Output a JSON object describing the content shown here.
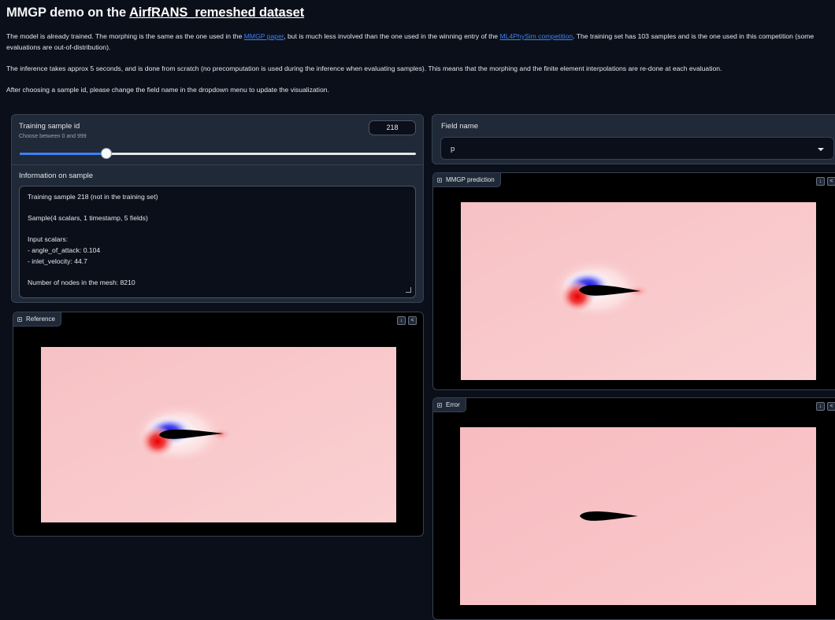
{
  "header": {
    "title_prefix": "MMGP demo on the ",
    "title_link": "AirfRANS_remeshed dataset"
  },
  "intro": {
    "p1_a": "The model is already trained. The morphing is the same as the one used in the ",
    "p1_link1": "MMGP paper",
    "p1_b": ", but is much less involved than the one used in the winning entry of the ",
    "p1_link2": "ML4PhySim competition",
    "p1_c": ". The training set has 103 samples and is the one used in this competition (some evaluations are out-of-distribution).",
    "p2": "The inference takes approx 5 seconds, and is done from scratch (no precomputation is used during the inference when evaluating samples). This means that the morphing and the finite element interpolations are re-done at each evaluation.",
    "p3": "After choosing a sample id, please change the field name in the dropdown menu to update the visualization."
  },
  "sample": {
    "label": "Training sample id",
    "info": "Choose between 0 and 999",
    "value": "218",
    "min": 0,
    "max": 999,
    "slider_fraction": 0.218
  },
  "information": {
    "label": "Information on sample",
    "text": "Training sample 218 (not in the training set)\n\nSample(4 scalars, 1 timestamp, 5 fields)\n\nInput scalars:\n- angle_of_attack: 0.104\n- inlet_velocity: 44.7\n\nNumber of nodes in the mesh: 8210"
  },
  "field": {
    "label": "Field name",
    "selected": "p"
  },
  "images": {
    "reference": "Reference",
    "prediction": "MMGP prediction",
    "error": "Error"
  },
  "icons": {
    "download": "download-icon",
    "share": "share-icon",
    "image": "image-icon",
    "dropdown": "chevron-down-icon"
  },
  "colors": {
    "background": "#0b0f19",
    "panel": "#1f2937",
    "accent": "#3b82f6",
    "field_base": "#f9c4c6",
    "high_pressure": "#e60000",
    "low_pressure": "#1a1aff"
  }
}
